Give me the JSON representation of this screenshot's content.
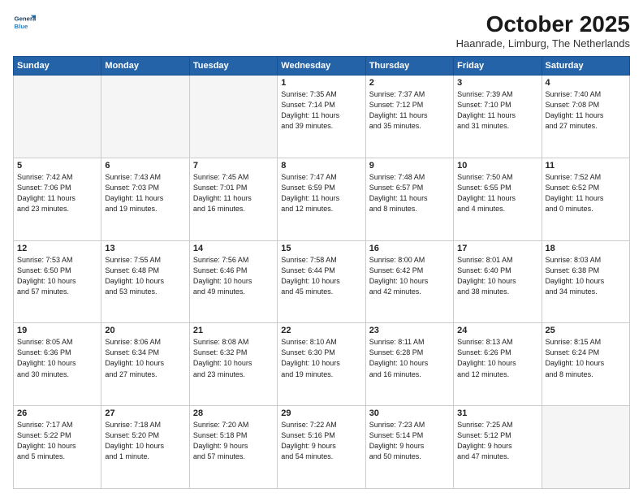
{
  "header": {
    "logo_line1": "General",
    "logo_line2": "Blue",
    "month": "October 2025",
    "location": "Haanrade, Limburg, The Netherlands"
  },
  "weekdays": [
    "Sunday",
    "Monday",
    "Tuesday",
    "Wednesday",
    "Thursday",
    "Friday",
    "Saturday"
  ],
  "weeks": [
    [
      {
        "day": "",
        "info": ""
      },
      {
        "day": "",
        "info": ""
      },
      {
        "day": "",
        "info": ""
      },
      {
        "day": "1",
        "info": "Sunrise: 7:35 AM\nSunset: 7:14 PM\nDaylight: 11 hours\nand 39 minutes."
      },
      {
        "day": "2",
        "info": "Sunrise: 7:37 AM\nSunset: 7:12 PM\nDaylight: 11 hours\nand 35 minutes."
      },
      {
        "day": "3",
        "info": "Sunrise: 7:39 AM\nSunset: 7:10 PM\nDaylight: 11 hours\nand 31 minutes."
      },
      {
        "day": "4",
        "info": "Sunrise: 7:40 AM\nSunset: 7:08 PM\nDaylight: 11 hours\nand 27 minutes."
      }
    ],
    [
      {
        "day": "5",
        "info": "Sunrise: 7:42 AM\nSunset: 7:06 PM\nDaylight: 11 hours\nand 23 minutes."
      },
      {
        "day": "6",
        "info": "Sunrise: 7:43 AM\nSunset: 7:03 PM\nDaylight: 11 hours\nand 19 minutes."
      },
      {
        "day": "7",
        "info": "Sunrise: 7:45 AM\nSunset: 7:01 PM\nDaylight: 11 hours\nand 16 minutes."
      },
      {
        "day": "8",
        "info": "Sunrise: 7:47 AM\nSunset: 6:59 PM\nDaylight: 11 hours\nand 12 minutes."
      },
      {
        "day": "9",
        "info": "Sunrise: 7:48 AM\nSunset: 6:57 PM\nDaylight: 11 hours\nand 8 minutes."
      },
      {
        "day": "10",
        "info": "Sunrise: 7:50 AM\nSunset: 6:55 PM\nDaylight: 11 hours\nand 4 minutes."
      },
      {
        "day": "11",
        "info": "Sunrise: 7:52 AM\nSunset: 6:52 PM\nDaylight: 11 hours\nand 0 minutes."
      }
    ],
    [
      {
        "day": "12",
        "info": "Sunrise: 7:53 AM\nSunset: 6:50 PM\nDaylight: 10 hours\nand 57 minutes."
      },
      {
        "day": "13",
        "info": "Sunrise: 7:55 AM\nSunset: 6:48 PM\nDaylight: 10 hours\nand 53 minutes."
      },
      {
        "day": "14",
        "info": "Sunrise: 7:56 AM\nSunset: 6:46 PM\nDaylight: 10 hours\nand 49 minutes."
      },
      {
        "day": "15",
        "info": "Sunrise: 7:58 AM\nSunset: 6:44 PM\nDaylight: 10 hours\nand 45 minutes."
      },
      {
        "day": "16",
        "info": "Sunrise: 8:00 AM\nSunset: 6:42 PM\nDaylight: 10 hours\nand 42 minutes."
      },
      {
        "day": "17",
        "info": "Sunrise: 8:01 AM\nSunset: 6:40 PM\nDaylight: 10 hours\nand 38 minutes."
      },
      {
        "day": "18",
        "info": "Sunrise: 8:03 AM\nSunset: 6:38 PM\nDaylight: 10 hours\nand 34 minutes."
      }
    ],
    [
      {
        "day": "19",
        "info": "Sunrise: 8:05 AM\nSunset: 6:36 PM\nDaylight: 10 hours\nand 30 minutes."
      },
      {
        "day": "20",
        "info": "Sunrise: 8:06 AM\nSunset: 6:34 PM\nDaylight: 10 hours\nand 27 minutes."
      },
      {
        "day": "21",
        "info": "Sunrise: 8:08 AM\nSunset: 6:32 PM\nDaylight: 10 hours\nand 23 minutes."
      },
      {
        "day": "22",
        "info": "Sunrise: 8:10 AM\nSunset: 6:30 PM\nDaylight: 10 hours\nand 19 minutes."
      },
      {
        "day": "23",
        "info": "Sunrise: 8:11 AM\nSunset: 6:28 PM\nDaylight: 10 hours\nand 16 minutes."
      },
      {
        "day": "24",
        "info": "Sunrise: 8:13 AM\nSunset: 6:26 PM\nDaylight: 10 hours\nand 12 minutes."
      },
      {
        "day": "25",
        "info": "Sunrise: 8:15 AM\nSunset: 6:24 PM\nDaylight: 10 hours\nand 8 minutes."
      }
    ],
    [
      {
        "day": "26",
        "info": "Sunrise: 7:17 AM\nSunset: 5:22 PM\nDaylight: 10 hours\nand 5 minutes."
      },
      {
        "day": "27",
        "info": "Sunrise: 7:18 AM\nSunset: 5:20 PM\nDaylight: 10 hours\nand 1 minute."
      },
      {
        "day": "28",
        "info": "Sunrise: 7:20 AM\nSunset: 5:18 PM\nDaylight: 9 hours\nand 57 minutes."
      },
      {
        "day": "29",
        "info": "Sunrise: 7:22 AM\nSunset: 5:16 PM\nDaylight: 9 hours\nand 54 minutes."
      },
      {
        "day": "30",
        "info": "Sunrise: 7:23 AM\nSunset: 5:14 PM\nDaylight: 9 hours\nand 50 minutes."
      },
      {
        "day": "31",
        "info": "Sunrise: 7:25 AM\nSunset: 5:12 PM\nDaylight: 9 hours\nand 47 minutes."
      },
      {
        "day": "",
        "info": ""
      }
    ]
  ]
}
